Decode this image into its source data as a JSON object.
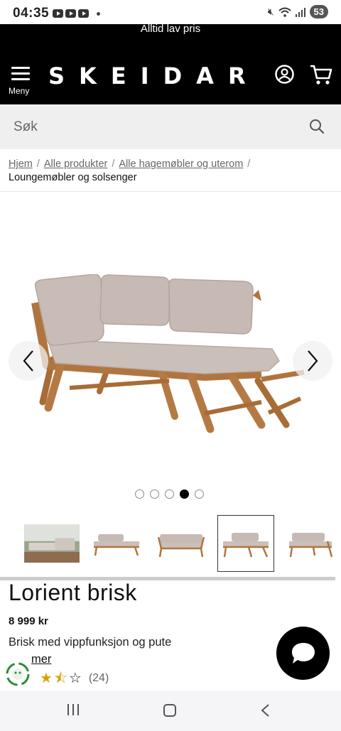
{
  "status_bar": {
    "time": "04:35",
    "battery": "53"
  },
  "header": {
    "promo": "Alltid lav pris",
    "menu_label": "Meny",
    "logo": "SKEIDAR"
  },
  "search": {
    "placeholder": "Søk"
  },
  "breadcrumb": {
    "items": [
      "Hjem",
      "Alle produkter",
      "Alle hagemøbler og uterom"
    ],
    "separator": "/",
    "current": "Loungemøbler og solsenger"
  },
  "carousel": {
    "image_count": 5,
    "active_index": 3
  },
  "thumbnails": {
    "count": 5,
    "selected_index": 3
  },
  "product": {
    "title": "Lorient brisk",
    "price": "8 999 kr",
    "description": "Brisk med vippfunksjon og pute",
    "read_more": "mer",
    "rating": 1.5,
    "rating_max": 3,
    "review_count": "(24)"
  },
  "colors": {
    "header_bg": "#000000",
    "search_bg": "#efefef",
    "star": "#d4a300",
    "wood": "#b0753f",
    "cushion": "#c9bcb7"
  }
}
